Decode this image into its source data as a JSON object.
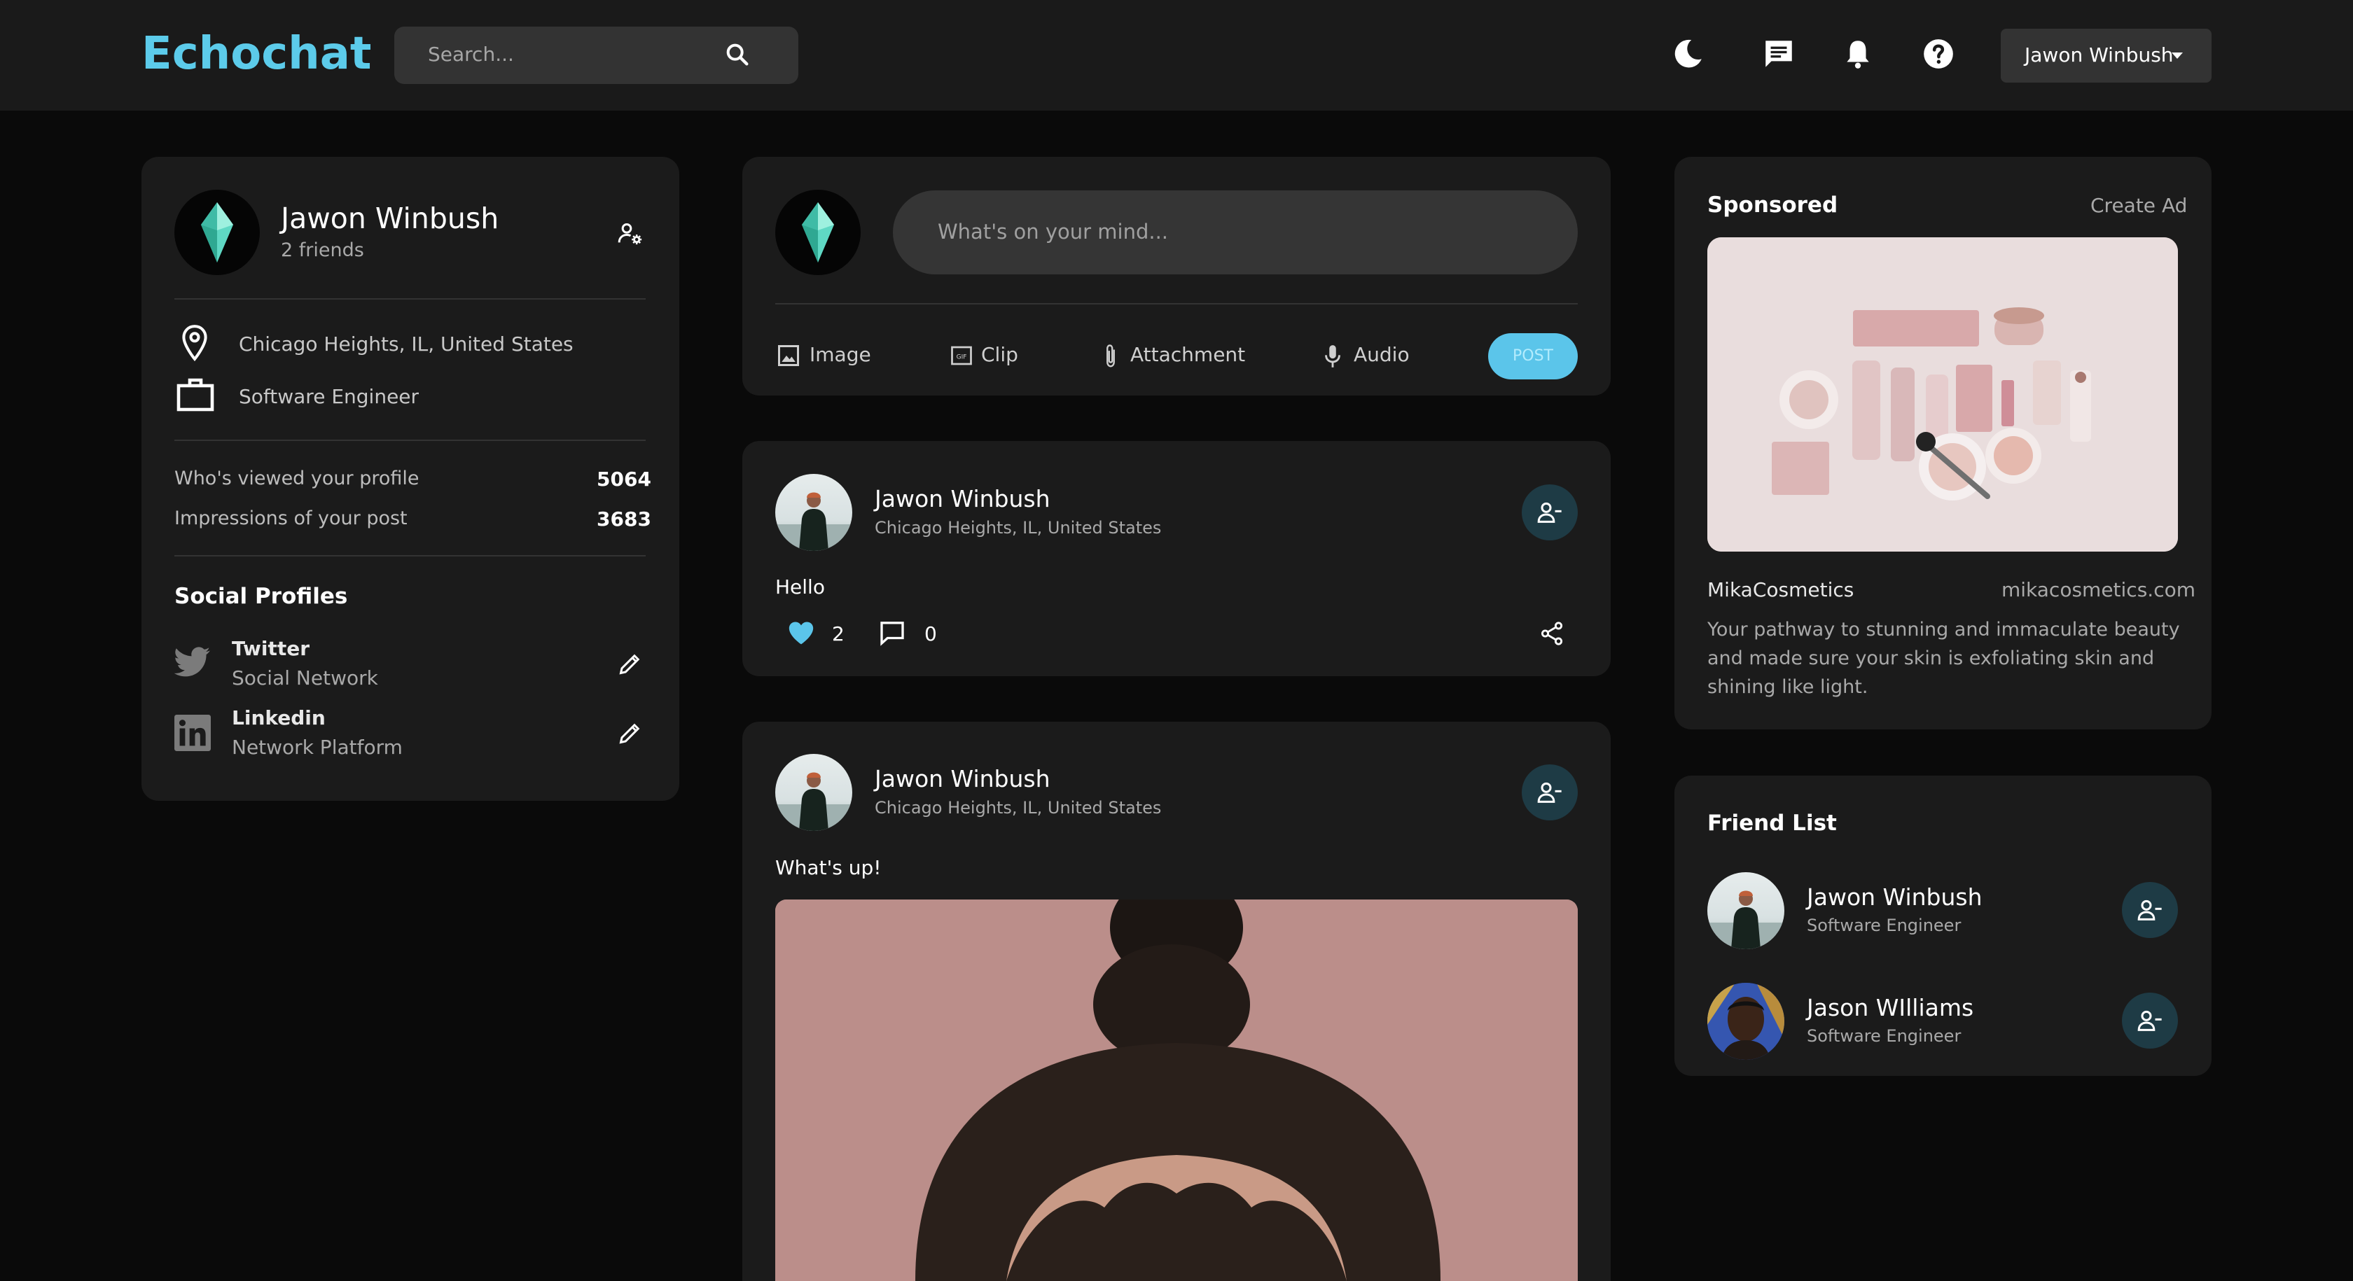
{
  "app": {
    "name": "Echochat"
  },
  "colors": {
    "accent": "#5ccbea",
    "background": "#0a0a0a",
    "card": "#1b1b1b",
    "like": "#5bc5ea"
  },
  "navbar": {
    "search_placeholder": "Search...",
    "icons": [
      "moon-icon",
      "message-icon",
      "bell-icon",
      "help-icon"
    ],
    "user_name": "Jawon Winbush"
  },
  "profile": {
    "name": "Jawon Winbush",
    "friends": "2 friends",
    "location": "Chicago Heights, IL, United States",
    "occupation": "Software Engineer",
    "stats": [
      {
        "label": "Who's viewed your profile",
        "value": "5064"
      },
      {
        "label": "Impressions of your post",
        "value": "3683"
      }
    ],
    "social_title": "Social Profiles",
    "socials": [
      {
        "name": "Twitter",
        "type": "Social Network"
      },
      {
        "name": "Linkedin",
        "type": "Network Platform"
      }
    ]
  },
  "composer": {
    "placeholder": "What's on your mind...",
    "actions": [
      "Image",
      "Clip",
      "Attachment",
      "Audio"
    ],
    "post_label": "POST"
  },
  "posts": [
    {
      "author": "Jawon Winbush",
      "location": "Chicago Heights, IL, United States",
      "text": "Hello",
      "likes": "2",
      "comments": "0"
    },
    {
      "author": "Jawon Winbush",
      "location": "Chicago Heights, IL, United States",
      "text": "What's up!"
    }
  ],
  "sponsored": {
    "title": "Sponsored",
    "create_ad": "Create Ad",
    "brand": "MikaCosmetics",
    "url": "mikacosmetics.com",
    "description_lines": [
      "Your pathway to stunning and immaculate beauty",
      "and made sure your skin is exfoliating skin and",
      "shining like light."
    ]
  },
  "friend_list": {
    "title": "Friend List",
    "friends": [
      {
        "name": "Jawon Winbush",
        "role": "Software Engineer"
      },
      {
        "name": "Jason WIlliams",
        "role": "Software Engineer"
      }
    ]
  }
}
